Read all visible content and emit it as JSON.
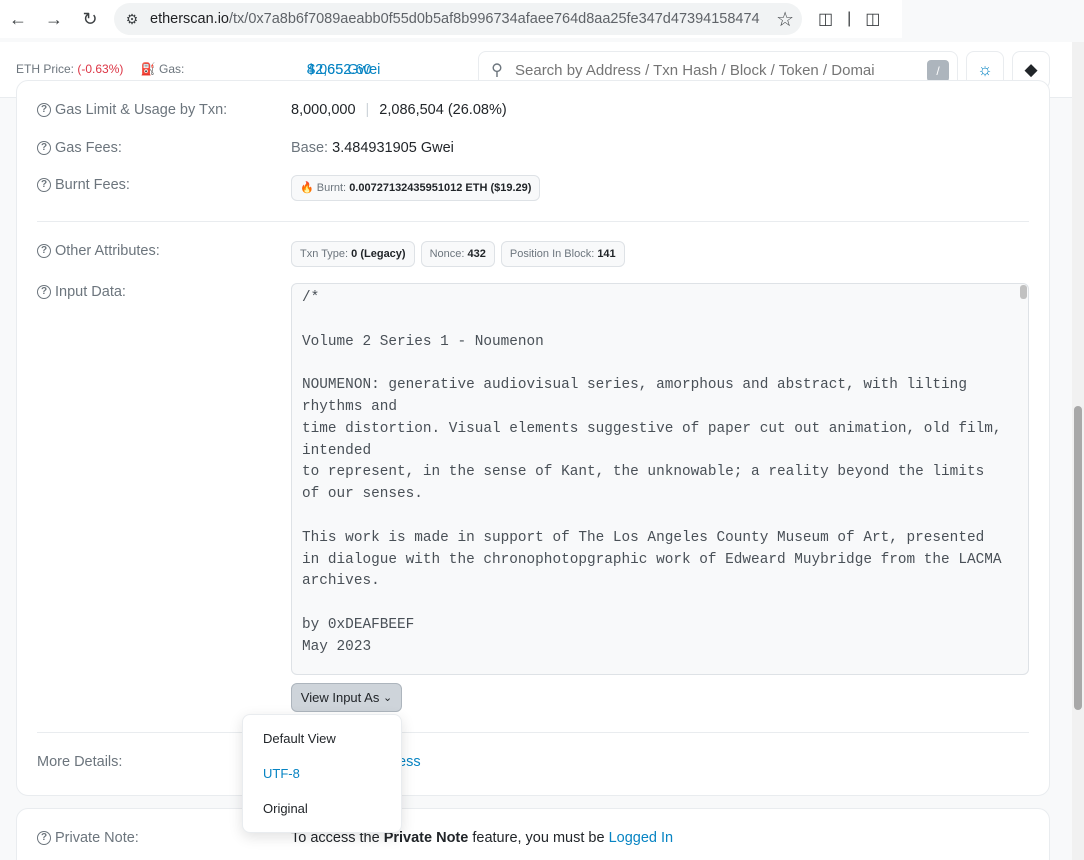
{
  "browser": {
    "url_domain": "etherscan.io",
    "url_path": "/tx/0x7a8b6f7089aeabb0f55d0b5af8b996734afaee764d8aa25fe347d47394158474"
  },
  "header": {
    "eth_price_label": "ETH Price:",
    "eth_price_value": "$2,652.60",
    "eth_price_change": "(-0.63%)",
    "gas_label": "Gas:",
    "gas_value": "4.065 Gwei",
    "search_placeholder": "Search by Address / Txn Hash / Block / Token / Domai",
    "search_shortcut": "/"
  },
  "details": {
    "gas_limit_label": "Gas Limit & Usage by Txn:",
    "gas_limit": "8,000,000",
    "gas_usage": "2,086,504 (26.08%)",
    "gas_fees_label": "Gas Fees:",
    "gas_fees_base_label": "Base:",
    "gas_fees_base": "3.484931905 Gwei",
    "burnt_fees_label": "Burnt Fees:",
    "burnt_label": "Burnt:",
    "burnt_value": "0.00727132435951012 ETH ($19.29)",
    "other_attributes_label": "Other Attributes:",
    "txn_type_label": "Txn Type:",
    "txn_type": "0 (Legacy)",
    "nonce_label": "Nonce:",
    "nonce": "432",
    "position_label": "Position In Block:",
    "position": "141",
    "input_data_label": "Input Data:",
    "input_data": "/*\n\nVolume 2 Series 1 - Noumenon\n\nNOUMENON: generative audiovisual series, amorphous and abstract, with lilting rhythms and\ntime distortion. Visual elements suggestive of paper cut out animation, old film, intended\nto represent, in the sense of Kant, the unknowable; a reality beyond the limits of our senses.\n\nThis work is made in support of The Los Angeles County Museum of Art, presented in dialogue with the chronophotopgraphic work of Edweard Muybridge from the LACMA archives.\n\nby 0xDEAFBEEF\nMay 2023",
    "view_input_as": "View Input As",
    "more_details_label": "More Details:",
    "more_details_link_tail": "ess",
    "private_note_label": "Private Note:",
    "private_note_prefix": "To access the",
    "private_note_bold": "Private Note",
    "private_note_mid": "feature, you must be",
    "private_note_link": "Logged In"
  },
  "dropdown": {
    "items": [
      "Default View",
      "UTF-8",
      "Original"
    ],
    "active": "UTF-8"
  }
}
